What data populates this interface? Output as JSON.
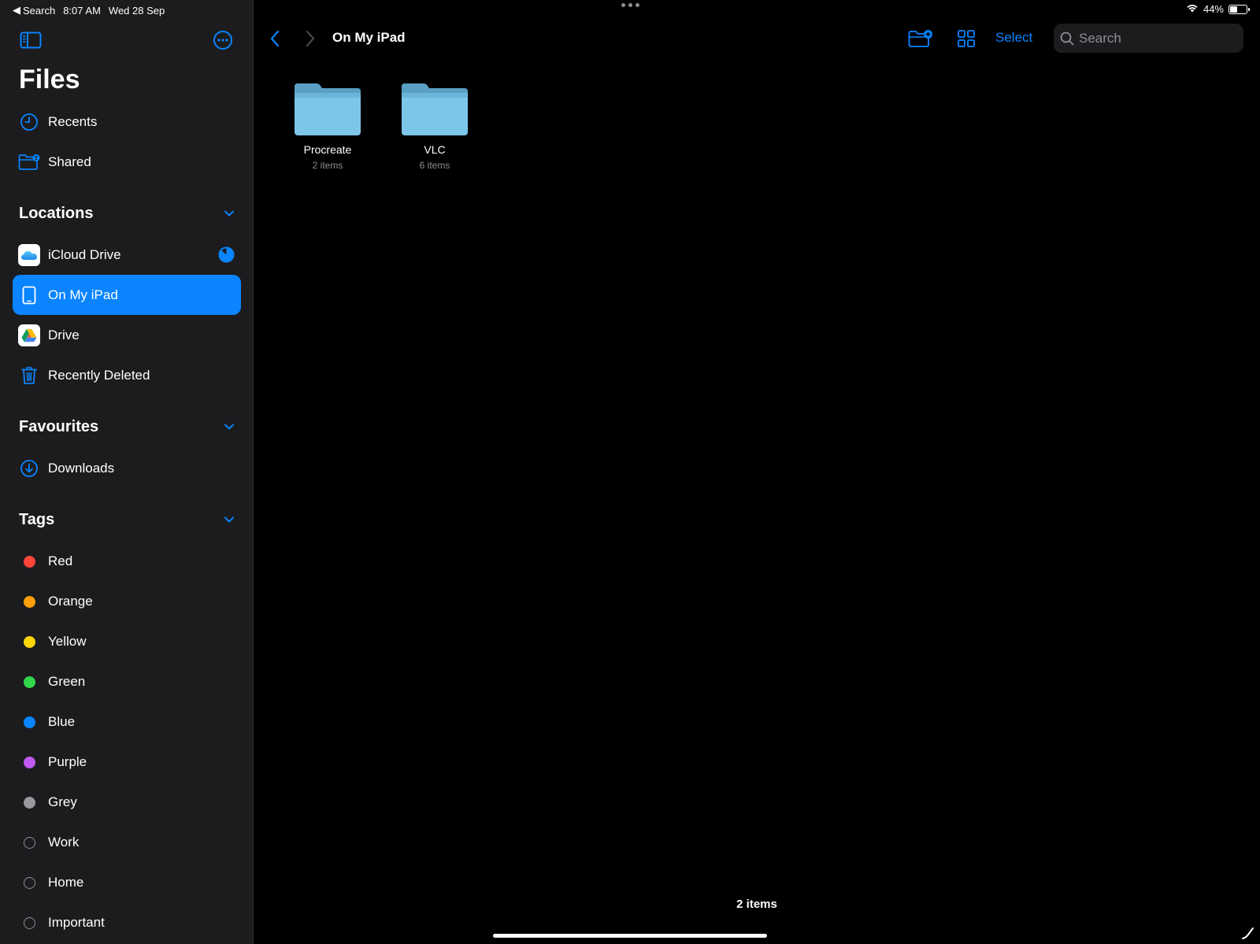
{
  "status": {
    "back_app": "Search",
    "time": "8:07 AM",
    "date": "Wed 28 Sep",
    "battery": "44%",
    "battery_level": 0.44
  },
  "sidebar": {
    "title": "Files",
    "top_items": [
      {
        "label": "Recents",
        "icon": "clock-icon"
      },
      {
        "label": "Shared",
        "icon": "shared-folder-icon"
      }
    ],
    "locations": {
      "title": "Locations",
      "items": [
        {
          "label": "iCloud Drive",
          "icon": "icloud-icon"
        },
        {
          "label": "On My iPad",
          "icon": "ipad-icon",
          "selected": true
        },
        {
          "label": "Drive",
          "icon": "google-drive-icon"
        },
        {
          "label": "Recently Deleted",
          "icon": "trash-icon"
        }
      ]
    },
    "favourites": {
      "title": "Favourites",
      "items": [
        {
          "label": "Downloads",
          "icon": "download-icon"
        }
      ]
    },
    "tags": {
      "title": "Tags",
      "items": [
        {
          "label": "Red",
          "color": "#ff453a"
        },
        {
          "label": "Orange",
          "color": "#ff9f0a"
        },
        {
          "label": "Yellow",
          "color": "#ffd60a"
        },
        {
          "label": "Green",
          "color": "#32d74b"
        },
        {
          "label": "Blue",
          "color": "#0a84ff"
        },
        {
          "label": "Purple",
          "color": "#bf5af2"
        },
        {
          "label": "Grey",
          "color": "#98989d"
        },
        {
          "label": "Work",
          "color": ""
        },
        {
          "label": "Home",
          "color": ""
        },
        {
          "label": "Important",
          "color": ""
        }
      ]
    }
  },
  "toolbar": {
    "title": "On My iPad",
    "select_label": "Select",
    "search_placeholder": "Search"
  },
  "folders": [
    {
      "name": "Procreate",
      "count": "2 items"
    },
    {
      "name": "VLC",
      "count": "6 items"
    }
  ],
  "footer": {
    "count": "2 items"
  },
  "colors": {
    "accent": "#0a84ff",
    "sidebar_bg": "#1c1c1e",
    "folder": "#7cc6ea"
  }
}
